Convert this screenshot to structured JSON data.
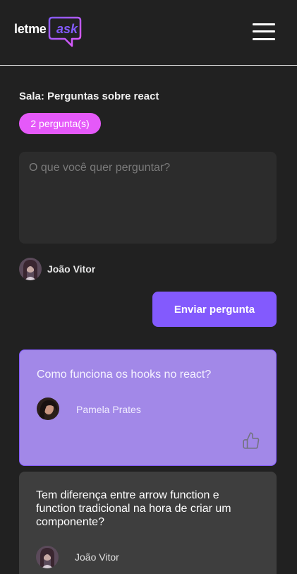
{
  "header": {
    "logo_text": "letme",
    "logo_accent": "ask",
    "menu_icon": "hamburger-menu-icon"
  },
  "room": {
    "title": "Sala: Perguntas sobre react",
    "question_count": "2 pergunta(s)"
  },
  "form": {
    "placeholder": "O que você quer perguntar?",
    "value": "",
    "user_name": "João Vitor",
    "submit_label": "Enviar pergunta"
  },
  "questions": [
    {
      "content": "Como funciona os hooks no react?",
      "author": "Pamela Prates",
      "highlighted": true,
      "like_icon": "thumbs-up-icon"
    },
    {
      "content": "Tem diferença entre arrow function e function tradicional na hora de criar um componente?",
      "author": "João Vitor",
      "highlighted": false
    }
  ],
  "colors": {
    "background": "#212121",
    "primary": "#835afd",
    "badge": "#e559f9",
    "card_highlight": "#a288e8",
    "card": "#3e3e3e",
    "input": "#2c2c2c"
  }
}
